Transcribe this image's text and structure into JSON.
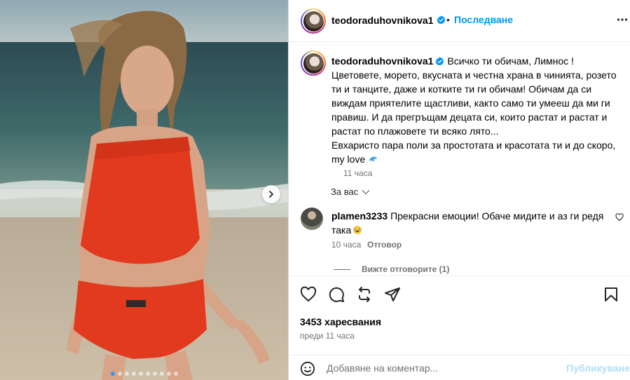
{
  "post": {
    "author": "teodoraduhovnikova1",
    "follow_label": "Последване",
    "caption": "Всичко ти обичам, Лимнос !\nЦветовете, морето, вкусната и честна храна в чинията, розето ти и танците, даже и котките ти ги обичам! Обичам да си виждам приятелите щастливи, както само ти умееш да ми ги правиш. И да прегръщам децата си, които растат и растат и растат по плажовете ти всяко лято...\nЕвхаристо пара поли за простотата и красотата ти и до скоро, my love",
    "caption_emoji": "dolphin-emoji",
    "caption_time": "11 часа",
    "for_you_label": "За вас",
    "likes": "3453 харесвания",
    "posted_ago": "преди 11 часа",
    "carousel": {
      "total": 10,
      "active": 0
    }
  },
  "comment": {
    "username": "plamen3233",
    "text": "Прекрасни емоции! Обаче мидите и аз ги редя така",
    "emoji": "laughing-emoji",
    "time": "10 часа",
    "reply_label": "Отговор",
    "view_replies": "Вижте отговорите (1)"
  },
  "composer": {
    "placeholder": "Добавяне на коментар...",
    "post_label": "Публикуване"
  },
  "colors": {
    "link_blue": "#0095f6",
    "verified_blue": "#0095f6",
    "muted": "#737373",
    "post_disabled": "#b2dffc"
  }
}
